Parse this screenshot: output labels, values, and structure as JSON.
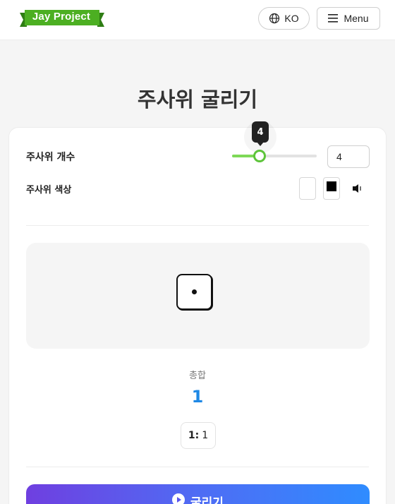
{
  "header": {
    "logo_text": "Jay Project",
    "logo_color": "#4caf22",
    "lang_label": "KO",
    "menu_label": "Menu"
  },
  "page": {
    "title": "주사위 굴리기"
  },
  "settings": {
    "count_label": "주사위 개수",
    "count_value": "4",
    "slider_tooltip": "4",
    "slider_fraction": 0.33,
    "color_label": "주사위 색상",
    "colors": [
      "#ffffff",
      "#000000"
    ],
    "sound_icon": "speaker-icon"
  },
  "dice": {
    "faces": [
      1
    ]
  },
  "result": {
    "sum_label": "총합",
    "sum_value": "1",
    "chip_key": "1:",
    "chip_value": "1"
  },
  "actions": {
    "roll_label": "굴리기"
  },
  "theme": {
    "accent_green": "#5dc43a",
    "sum_color": "#1e88e5"
  }
}
